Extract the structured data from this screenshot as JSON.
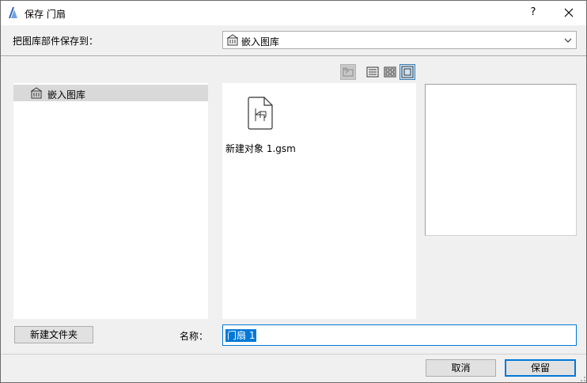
{
  "window": {
    "title": "保存 门扇",
    "help_label": "?",
    "app_icon": "archicad-logo-icon",
    "close_icon": "close-icon"
  },
  "save_to": {
    "label": "把图库部件保存到：",
    "selected": "嵌入图库",
    "icon": "library-icon"
  },
  "view_buttons": [
    {
      "name": "up-folder-icon",
      "state": "disabled"
    },
    {
      "name": "list-view-icon",
      "state": "normal"
    },
    {
      "name": "icon-view-icon",
      "state": "normal"
    },
    {
      "name": "preview-view-icon",
      "state": "active"
    }
  ],
  "tree": {
    "items": [
      {
        "label": "嵌入图库",
        "icon": "library-icon",
        "selected": true
      }
    ]
  },
  "files": {
    "items": [
      {
        "name": "新建对象 1.gsm",
        "icon": "chair-document-icon"
      }
    ]
  },
  "new_folder_label": "新建文件夹",
  "name_field": {
    "label": "名称：",
    "value": "门扇 1"
  },
  "buttons": {
    "cancel": "取消",
    "save": "保留"
  },
  "colors": {
    "accent": "#0078d7",
    "selection": "#d9d9d9",
    "dialog_bg": "#f0f0f0"
  }
}
